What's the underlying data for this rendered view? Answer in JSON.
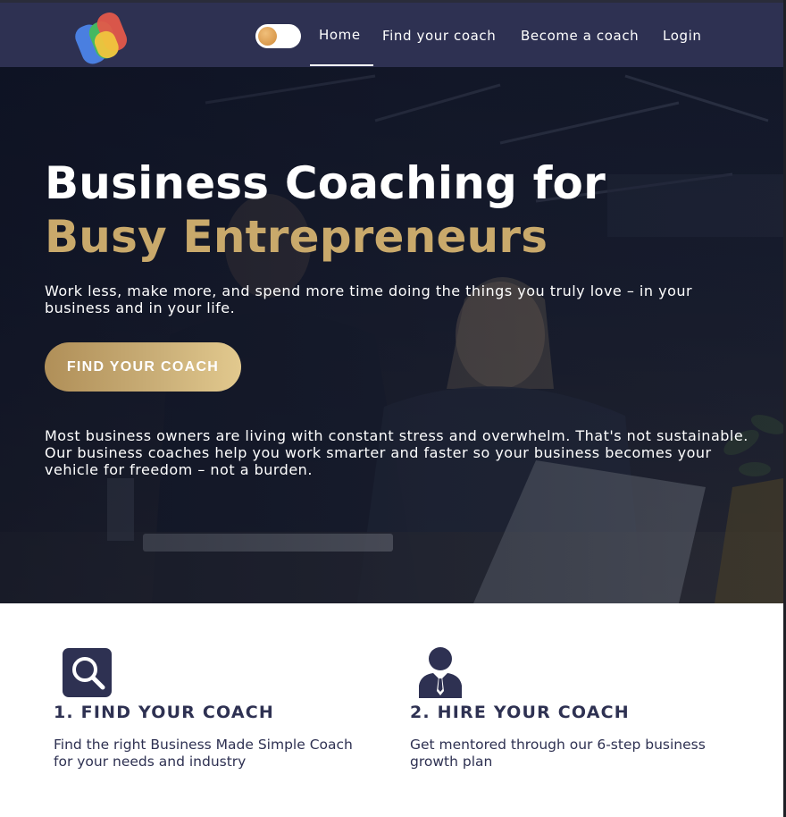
{
  "nav": {
    "logo_icon": "brand-logo-icon",
    "theme_toggle_icon": "theme-toggle",
    "links": [
      {
        "label": "Home",
        "active": true
      },
      {
        "label": "Find your coach"
      },
      {
        "label": "Become a coach"
      },
      {
        "label": "Login"
      }
    ]
  },
  "hero": {
    "title_line1": "Business Coaching for",
    "title_line2": "Busy Entrepreneurs",
    "subtitle": "Work less, make more, and spend more time doing the things you truly love – in your business and in your life.",
    "cta_label": "FIND YOUR COACH",
    "body": "Most business owners are living with constant stress and overwhelm. That's not sustainable. Our business coaches help you work smarter and faster so your business becomes your vehicle for freedom – not a burden."
  },
  "steps": [
    {
      "icon": "search-icon",
      "title": "1. FIND YOUR COACH",
      "description": "Find the right Business Made Simple Coach for your needs and industry"
    },
    {
      "icon": "business-person-icon",
      "title": "2. HIRE YOUR COACH",
      "description": "Get mentored through our 6-step business growth plan"
    }
  ],
  "colors": {
    "navy": "#2e3152",
    "gold": "#c9a96b",
    "white": "#ffffff"
  }
}
